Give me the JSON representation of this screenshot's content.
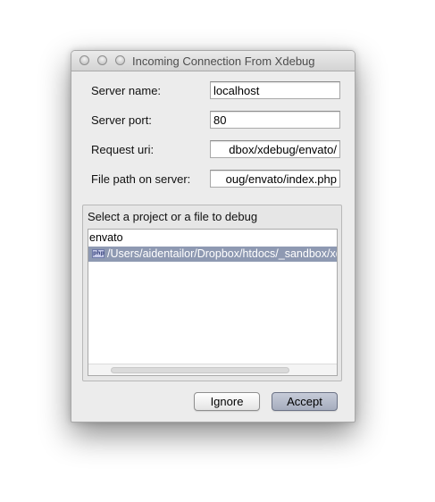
{
  "window": {
    "title": "Incoming Connection From Xdebug"
  },
  "form": {
    "server_name": {
      "label": "Server name:",
      "value": "localhost"
    },
    "server_port": {
      "label": "Server port:",
      "value": "80"
    },
    "request_uri": {
      "label": "Request uri:",
      "value": "dbox/xdebug/envato/"
    },
    "file_path": {
      "label": "File path on server:",
      "value": "oug/envato/index.php"
    }
  },
  "project_group": {
    "label": "Select a project or a file to debug",
    "tree": {
      "root": "envato",
      "items": [
        {
          "icon": "php-file-icon",
          "icon_text": "php",
          "label": "/Users/aidentailor/Dropbox/htdocs/_sandbox/xdebug/envato/index.php",
          "selected": true
        }
      ]
    }
  },
  "buttons": {
    "ignore": "Ignore",
    "accept": "Accept"
  },
  "colors": {
    "selection": "#8e99b2",
    "dialog_bg": "#ececec",
    "accept_button": "#b3b9c9"
  }
}
